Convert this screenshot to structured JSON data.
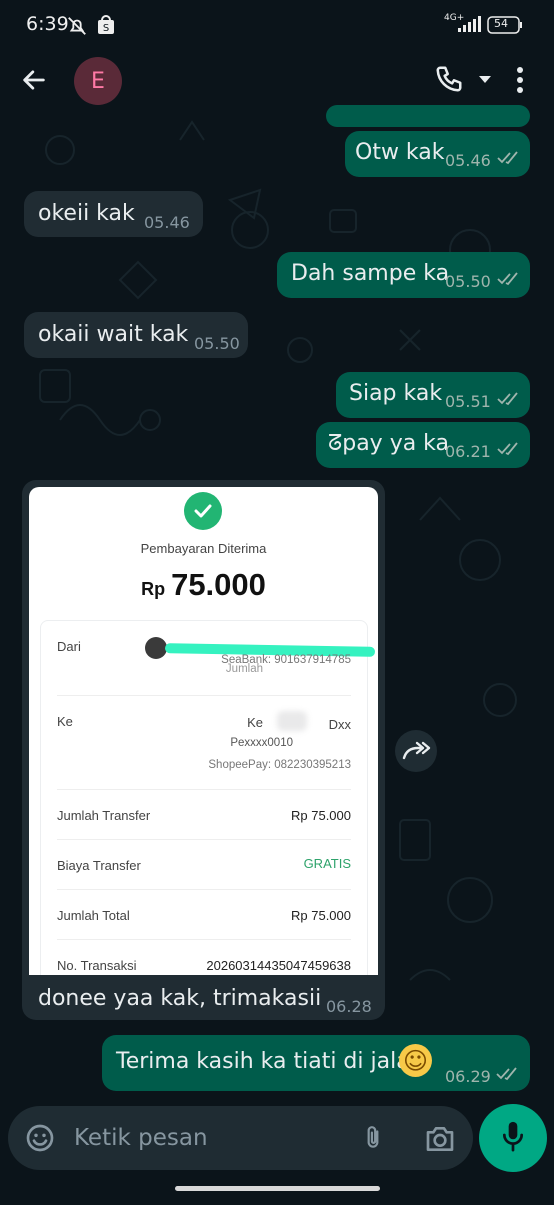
{
  "status_bar": {
    "time": "6:39",
    "network": "4G+",
    "battery": "54"
  },
  "header": {
    "avatar_letter": "E"
  },
  "messages": [
    {
      "text": "Otw kak",
      "time": "05.46"
    },
    {
      "text": "okeii kak",
      "time": "05.46"
    },
    {
      "text": "Dah sampe ka",
      "time": "05.50"
    },
    {
      "text": "okaii wait kak",
      "time": "05.50"
    },
    {
      "text": "Siap kak",
      "time": "05.51"
    },
    {
      "text": "ᘔpay ya ka",
      "time": "06.21"
    },
    {
      "text": "donee yaa kak, trimakasii",
      "time": "06.28"
    },
    {
      "text": "Terima kasih ka tiati di jalan",
      "emoji": "☺",
      "time": "06.29"
    }
  ],
  "receipt": {
    "title": "Pembayaran Diterima",
    "currency": "Rp",
    "amount": "75.000",
    "from_label": "Dari",
    "from_sub1": "Jumlah",
    "from_sub2": "SeaBank: 901637914785",
    "to_label": "Ke",
    "to_name1": "Ke",
    "to_name2": "Dxx",
    "to_sub1": "Pexxxx0010",
    "to_sub2": "ShopeePay: 082230395213",
    "rows": [
      {
        "label": "Jumlah Transfer",
        "value": "Rp 75.000"
      },
      {
        "label": "Biaya Transfer",
        "value": "GRATIS"
      },
      {
        "label": "Jumlah Total",
        "value": "Rp 75.000"
      },
      {
        "label": "No. Transaksi",
        "value": "20260314435047459638"
      }
    ]
  },
  "composer": {
    "placeholder": "Ketik pesan"
  },
  "colors": {
    "outgoing": "#005c4b",
    "incoming": "#202c33",
    "accent": "#00a884",
    "background": "#0b141a"
  },
  "icons": [
    "back-arrow-icon",
    "phone-icon",
    "chevron-down-icon",
    "more-vert-icon",
    "double-check-icon",
    "check-circle-icon",
    "forward-icon",
    "emoji-icon",
    "attach-icon",
    "camera-icon",
    "mic-icon"
  ]
}
